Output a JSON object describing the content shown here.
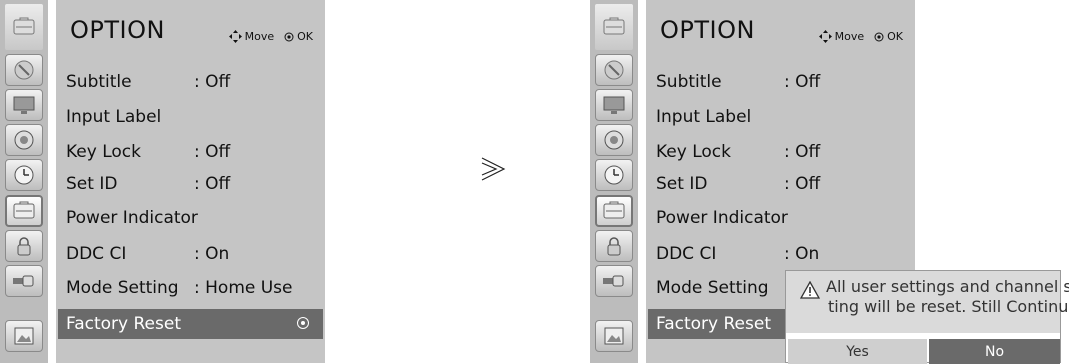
{
  "arrow_glyph": "≫",
  "left": {
    "title": "OPTION",
    "hints": {
      "move_label": "Move",
      "ok_label": "OK"
    },
    "sidebar_icons": [
      "option-icon",
      "satellite-icon",
      "monitor-icon",
      "audio-icon",
      "clock-icon",
      "option-icon",
      "lock-icon",
      "input-icon",
      "picture-icon"
    ],
    "rows": [
      {
        "label": "Subtitle",
        "value": ": Off"
      },
      {
        "label": "Input Label",
        "value": ""
      },
      {
        "label": "Key Lock",
        "value": ": Off"
      },
      {
        "label": "Set ID",
        "value": ": Off"
      },
      {
        "label": "Power Indicator",
        "value": ""
      },
      {
        "label": "DDC CI",
        "value": ": On"
      },
      {
        "label": "Mode Setting",
        "value": ": Home Use"
      },
      {
        "label": "Factory Reset",
        "value": ""
      }
    ]
  },
  "right": {
    "title": "OPTION",
    "hints": {
      "move_label": "Move",
      "ok_label": "OK"
    },
    "rows": [
      {
        "label": "Subtitle",
        "value": ": Off"
      },
      {
        "label": "Input Label",
        "value": ""
      },
      {
        "label": "Key Lock",
        "value": ": Off"
      },
      {
        "label": "Set ID",
        "value": ": Off"
      },
      {
        "label": "Power Indicator",
        "value": ""
      },
      {
        "label": "DDC CI",
        "value": ": On"
      },
      {
        "label": "Mode Setting",
        "value": ""
      },
      {
        "label": "Factory Reset",
        "value": ""
      }
    ],
    "popup": {
      "line1": "All user settings and channel set-",
      "line2": "ting will be reset. Still Continue?",
      "yes_label": "Yes",
      "no_label": "No"
    }
  }
}
